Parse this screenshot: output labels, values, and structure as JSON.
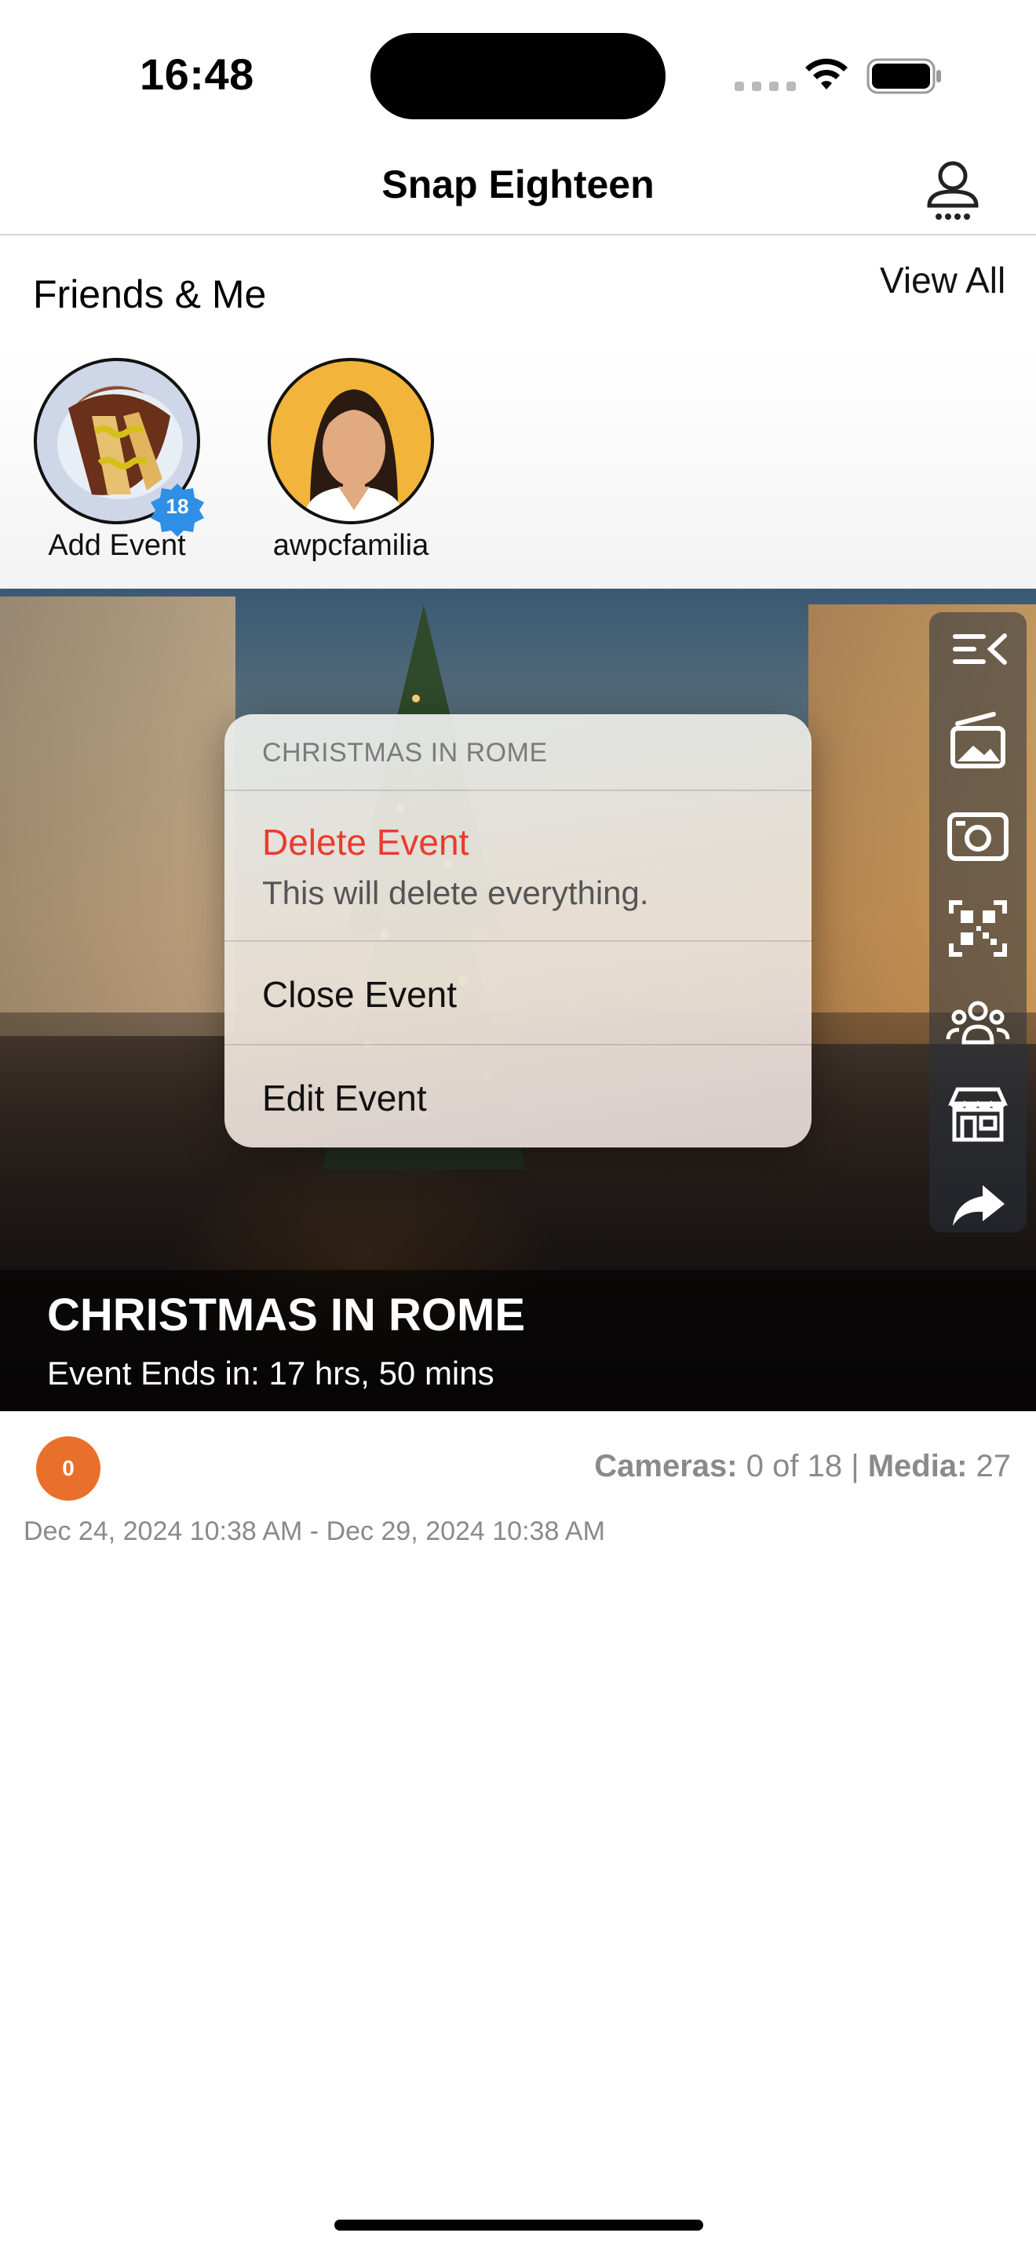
{
  "status_bar": {
    "time": "16:48"
  },
  "nav": {
    "title": "Snap Eighteen",
    "profile_icon": "user-profile-icon"
  },
  "friends": {
    "title": "Friends & Me",
    "view_all": "View All",
    "items": [
      {
        "label": "Add Event",
        "badge": "18",
        "icon": "event-photo-avatar"
      },
      {
        "label": "awpcfamilia",
        "icon": "woman-avatar"
      }
    ]
  },
  "event": {
    "title": "CHRISTMAS IN ROME",
    "ends_in": "Event Ends in: 17 hrs, 50 mins",
    "side_actions": [
      "menu-collapse-icon",
      "gallery-icon",
      "camera-icon",
      "qr-code-icon",
      "guests-icon",
      "store-icon",
      "share-icon"
    ]
  },
  "context_menu": {
    "header": "CHRISTMAS IN ROME",
    "delete_label": "Delete Event",
    "delete_sub": "This will delete everything.",
    "close_label": "Close Event",
    "edit_label": "Edit Event"
  },
  "details": {
    "count": "0",
    "cameras_label": "Cameras:",
    "cameras_value": " 0 of 18 ",
    "separator": "| ",
    "media_label": "Media:",
    "media_value": " 27",
    "dates": "Dec 24, 2024 10:38 AM - Dec 29, 2024 10:38 AM"
  },
  "colors": {
    "accent_orange": "#e8702a",
    "destructive": "#ea3b2e",
    "badge_blue": "#2f8fe6"
  }
}
